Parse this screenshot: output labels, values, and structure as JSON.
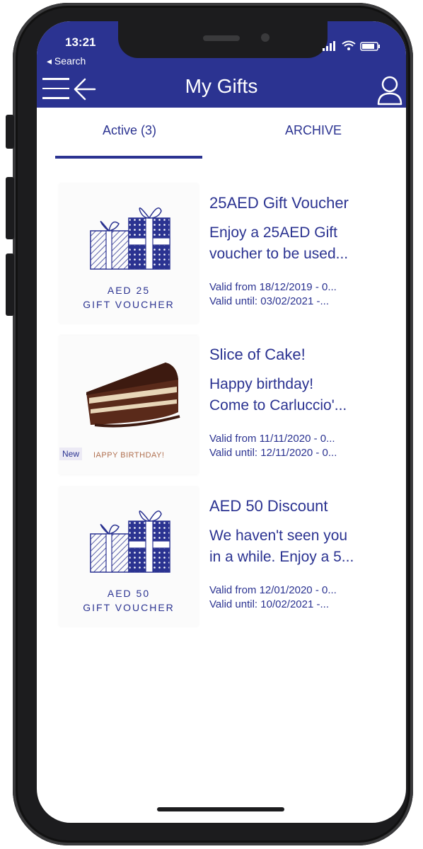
{
  "status_bar": {
    "time": "13:21",
    "back_label": "◂ Search"
  },
  "header": {
    "title": "My Gifts"
  },
  "tabs": {
    "active": "Active (3)",
    "archive": "ARCHIVE"
  },
  "gifts": [
    {
      "title": "25AED Gift Voucher",
      "desc_line1": "Enjoy a 25AED Gift",
      "desc_line2": "voucher to be used...",
      "valid_from": "Valid from 18/12/2019 - 0...",
      "valid_until": "Valid until: 03/02/2021 -...",
      "caption_line1": "AED 25",
      "caption_line2": "GIFT VOUCHER"
    },
    {
      "title": "Slice of Cake!",
      "desc_line1": "Happy birthday!",
      "desc_line2": "Come to Carluccio'...",
      "valid_from": "Valid from 11/11/2020 - 0...",
      "valid_until": "Valid until: 12/11/2020 - 0...",
      "badge": "New",
      "caption": "IAPPY BIRTHDAY!"
    },
    {
      "title": "AED 50 Discount",
      "desc_line1": "We haven't seen you",
      "desc_line2": "in a while. Enjoy a 5...",
      "valid_from": "Valid from 12/01/2020 - 0...",
      "valid_until": "Valid until: 10/02/2021 -...",
      "caption_line1": "AED 50",
      "caption_line2": "GIFT VOUCHER"
    }
  ],
  "colors": {
    "brand": "#2b3391",
    "background": "#ffffff",
    "accent_text": "#b07050"
  },
  "icons": [
    "hamburger-icon",
    "back-arrow-icon",
    "profile-icon",
    "signal-icon",
    "wifi-icon",
    "battery-icon",
    "gift-boxes-icon",
    "cake-slice-icon"
  ]
}
